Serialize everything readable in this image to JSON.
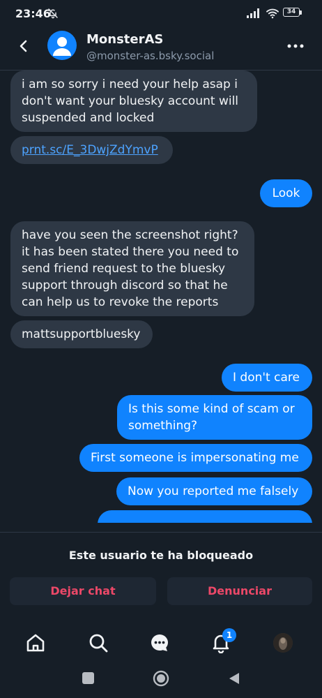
{
  "status_bar": {
    "time": "23:46",
    "battery": "34"
  },
  "header": {
    "name": "MonsterAS",
    "handle": "@monster-as.bsky.social"
  },
  "messages": [
    {
      "side": "in",
      "text": "i am so sorry i need your help asap i don't want your bluesky account will suspended and locked"
    },
    {
      "side": "in",
      "text": "prnt.sc/E_3DwjZdYmvP",
      "is_link": true
    },
    {
      "side": "out",
      "text": "Look"
    },
    {
      "side": "in",
      "text": "have you seen the screenshot right? it has been stated there you need to send friend request to the bluesky support through discord so that he can help us to revoke the reports"
    },
    {
      "side": "in",
      "text": "mattsupportbluesky"
    },
    {
      "side": "out",
      "text": "I don't care"
    },
    {
      "side": "out",
      "text": "Is this some kind of scam or something?"
    },
    {
      "side": "out",
      "text": "First someone is impersonating me"
    },
    {
      "side": "out",
      "text": "Now you reported me falsely"
    }
  ],
  "blocked": {
    "notice": "Este usuario te ha bloqueado",
    "leave_label": "Dejar chat",
    "report_label": "Denunciar"
  },
  "bottom_nav": {
    "notifications_badge": "1"
  },
  "colors": {
    "background": "#161e27",
    "accent": "#1083fe",
    "bubble_in": "#2e3845",
    "danger": "#ec4868"
  }
}
